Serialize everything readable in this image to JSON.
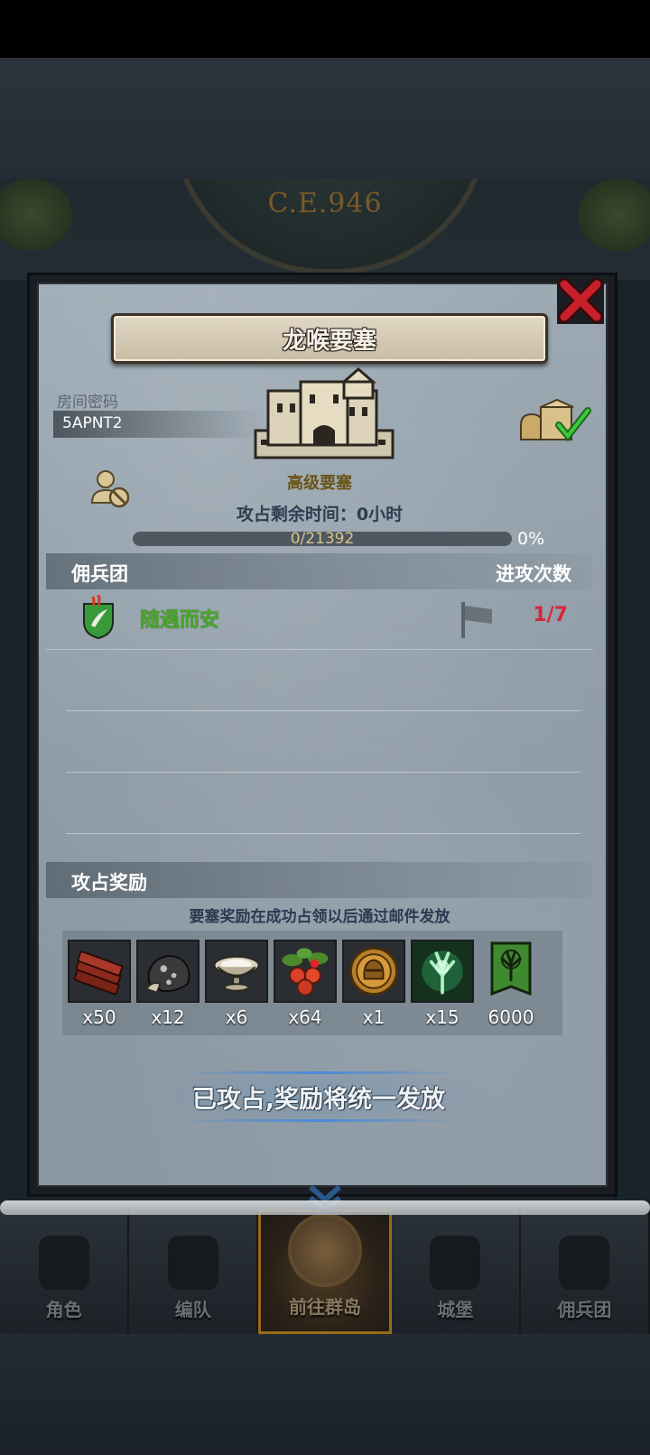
{
  "background": {
    "era_label": "C.E.946"
  },
  "modal": {
    "title": "龙喉要塞",
    "room_password_label": "房间密码",
    "room_password": "5APNT2",
    "castle_label": "高级要塞",
    "occupation_time_label": "攻占剩余时间：",
    "occupation_time_value": "0",
    "occupation_time_unit": "小时",
    "progress_text": "0/21392",
    "progress_percent": "0%",
    "progress_fraction": 0.0,
    "mercenary_section": {
      "left_label": "佣兵团",
      "right_label": "进攻次数"
    },
    "mercenaries": [
      {
        "name": "随遇而安",
        "attack_count": "1/7"
      }
    ],
    "reward_section": {
      "label": "攻占奖励",
      "hint": "要塞奖励在成功占领以后通过邮件发放"
    },
    "rewards": [
      {
        "icon": "wood-planks-icon",
        "count": "x50"
      },
      {
        "icon": "coal-ore-icon",
        "count": "x12"
      },
      {
        "icon": "silver-bowl-icon",
        "count": "x6"
      },
      {
        "icon": "berries-icon",
        "count": "x64"
      },
      {
        "icon": "knight-coin-icon",
        "count": "x1"
      },
      {
        "icon": "green-spirit-icon",
        "count": "x15"
      },
      {
        "icon": "guild-banner-icon",
        "count": "6000"
      }
    ],
    "status_button": "已攻占,奖励将统一发放"
  },
  "bottom_nav": [
    {
      "label": "角色",
      "active": false
    },
    {
      "label": "编队",
      "active": false
    },
    {
      "label": "前往群岛",
      "active": true
    },
    {
      "label": "城堡",
      "active": false
    },
    {
      "label": "佣兵团",
      "active": false
    }
  ],
  "colors": {
    "merc_name": "#4aa82a",
    "attack_count": "#d7263a",
    "castle_label": "#6a5418",
    "close_red": "#c8202a"
  }
}
